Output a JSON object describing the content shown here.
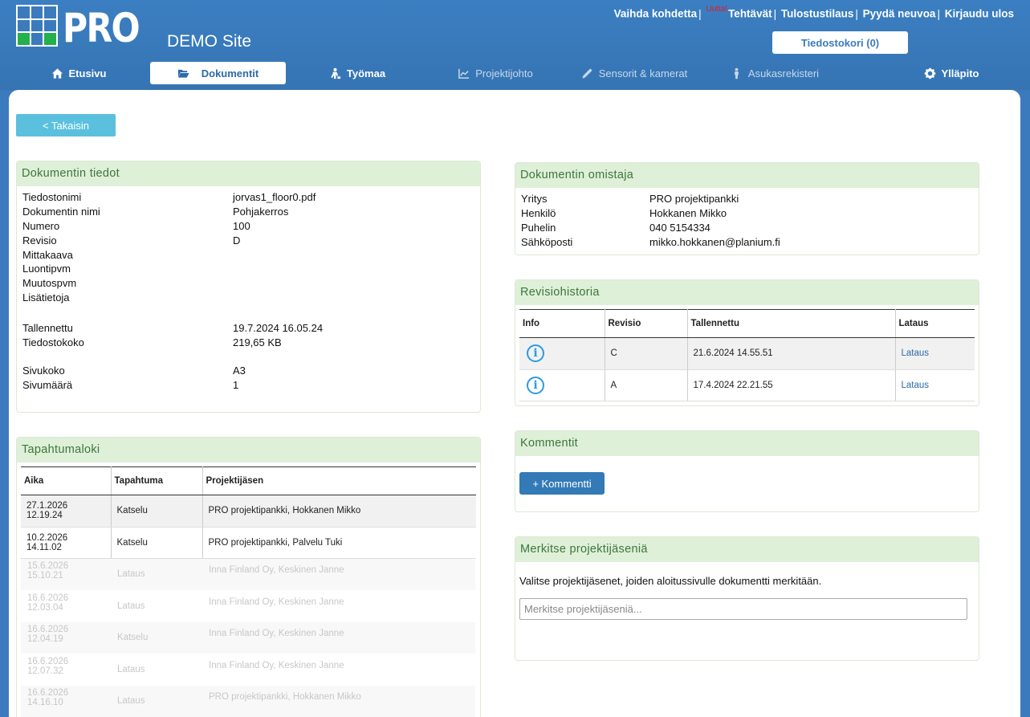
{
  "header": {
    "logo_text": "PRO",
    "site_name": "DEMO Site",
    "top_links": {
      "change_site": "Vaihda kohdetta",
      "new_badge": "Uutta!",
      "tasks": "Tehtävät",
      "print_order": "Tulostustilaus",
      "ask_advice": "Pyydä neuvoa",
      "logout": "Kirjaudu ulos"
    },
    "cart_label": "Tiedostokori (0)"
  },
  "nav": {
    "home": "Etusivu",
    "documents": "Dokumentit",
    "worksite": "Työmaa",
    "project_mgmt": "Projektijohto",
    "sensors": "Sensorit & kamerat",
    "residents": "Asukasrekisteri",
    "admin": "Ylläpito"
  },
  "back_label": "< Takaisin",
  "doc_info": {
    "title": "Dokumentin tiedot",
    "rows": [
      {
        "k": "Tiedostonimi",
        "v": "jorvas1_floor0.pdf"
      },
      {
        "k": "Dokumentin nimi",
        "v": "Pohjakerros"
      },
      {
        "k": "Numero",
        "v": "100"
      },
      {
        "k": "Revisio",
        "v": "D"
      },
      {
        "k": "Mittakaava",
        "v": ""
      },
      {
        "k": "Luontipvm",
        "v": ""
      },
      {
        "k": "Muutospvm",
        "v": ""
      },
      {
        "k": "Lisätietoja",
        "v": ""
      }
    ],
    "rows2": [
      {
        "k": "Tallennettu",
        "v": "19.7.2024 16.05.24"
      },
      {
        "k": "Tiedostokoko",
        "v": "219,65 KB"
      }
    ],
    "rows3": [
      {
        "k": "Sivukoko",
        "v": "A3"
      },
      {
        "k": "Sivumäärä",
        "v": "1"
      }
    ]
  },
  "owner": {
    "title": "Dokumentin omistaja",
    "rows": [
      {
        "k": "Yritys",
        "v": "PRO projektipankki"
      },
      {
        "k": "Henkilö",
        "v": "Hokkanen Mikko"
      },
      {
        "k": "Puhelin",
        "v": "040 5154334"
      },
      {
        "k": "Sähköposti",
        "v": "mikko.hokkanen@planium.fi"
      }
    ]
  },
  "revisions": {
    "title": "Revisiohistoria",
    "headers": [
      "Info",
      "Revisio",
      "Tallennettu",
      "Lataus"
    ],
    "rows": [
      {
        "rev": "C",
        "saved": "21.6.2024 14.55.51",
        "dl": "Lataus"
      },
      {
        "rev": "A",
        "saved": "17.4.2024 22.21.55",
        "dl": "Lataus"
      }
    ]
  },
  "comments": {
    "title": "Kommentit",
    "button": "+ Kommentti"
  },
  "mark": {
    "title": "Merkitse projektijäseniä",
    "text": "Valitse projektijäsenet, joiden aloitussivulle dokumentti merkitään.",
    "placeholder": "Merkitse projektijäseniä..."
  },
  "log": {
    "title": "Tapahtumaloki",
    "headers": [
      "Aika",
      "Tapahtuma",
      "Projektijäsen"
    ],
    "rows": [
      {
        "date": "27.1.2026",
        "time": "12.19.24",
        "event": "Katselu",
        "member": "PRO projektipankki, Hokkanen Mikko"
      },
      {
        "date": "10.2.2026",
        "time": "14.11.02",
        "event": "Katselu",
        "member": "PRO projektipankki, Palvelu Tuki"
      }
    ],
    "ghost_rows": [
      {
        "date": "15.6.2026",
        "time": "15.10.21",
        "event": "Lataus",
        "member": "Inna Finland Oy, Keskinen Janne"
      },
      {
        "date": "16.6.2026",
        "time": "12.03.04",
        "event": "Lataus",
        "member": "Inna Finland Oy, Keskinen Janne"
      },
      {
        "date": "16.6.2026",
        "time": "12.04.19",
        "event": "Katselu",
        "member": "Inna Finland Oy, Keskinen Janne"
      },
      {
        "date": "16.6.2026",
        "time": "12.07.32",
        "event": "Lataus",
        "member": "Inna Finland Oy, Keskinen Janne"
      },
      {
        "date": "16.6.2026",
        "time": "14.16.10",
        "event": "Lataus",
        "member": "PRO projektipankki, Hokkanen Mikko"
      }
    ]
  }
}
